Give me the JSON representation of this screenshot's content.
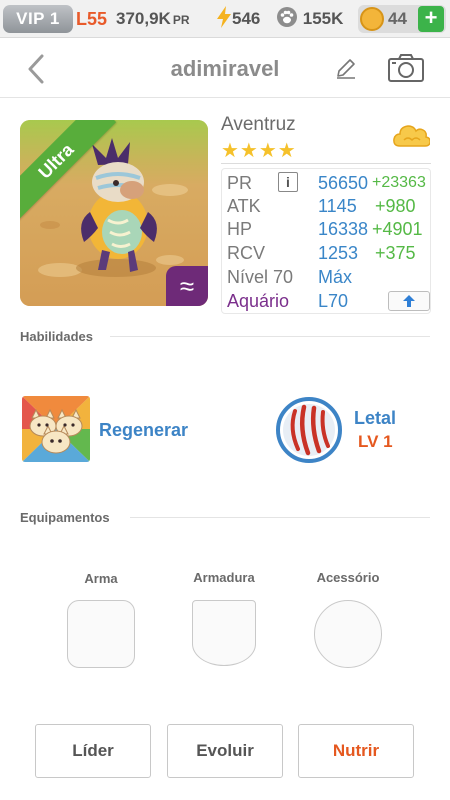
{
  "status_bar": {
    "vip_label": "VIP 1",
    "level": "L55",
    "power": "370,9K",
    "power_unit": "PR",
    "energy": "546",
    "paw_points": "155K",
    "coins": "44",
    "add_label": "+"
  },
  "header": {
    "title": "adimiravel"
  },
  "pet": {
    "name": "Aventruz",
    "rarity": "Ultra",
    "stars": "★★★★",
    "element_symbol": "≈",
    "stats": [
      {
        "label": "PR",
        "value": "56650",
        "bonus": "+23363"
      },
      {
        "label": "ATK",
        "value": "1145",
        "bonus": "+980"
      },
      {
        "label": "HP",
        "value": "16338",
        "bonus": "+4901"
      },
      {
        "label": "RCV",
        "value": "1253",
        "bonus": "+375"
      }
    ],
    "level_label": "Nível 70",
    "level_value": "Máx",
    "habitat_label": "Aquário",
    "habitat_value": "L70"
  },
  "abilities": {
    "title": "Habilidades",
    "ability": {
      "name": "Regenerar"
    },
    "skill": {
      "name": "Letal",
      "level": "LV 1"
    }
  },
  "equipment": {
    "title": "Equipamentos",
    "slots": [
      {
        "label": "Arma"
      },
      {
        "label": "Armadura"
      },
      {
        "label": "Acessório"
      }
    ]
  },
  "actions": {
    "leader": "Líder",
    "evolve": "Evoluir",
    "feed": "Nutrir"
  },
  "colors": {
    "accent_blue": "#3d84c6",
    "bonus_green": "#55b946",
    "warning_orange": "#e5581f",
    "ultra_green": "#58ad3b",
    "element_purple": "#6e2a78"
  }
}
